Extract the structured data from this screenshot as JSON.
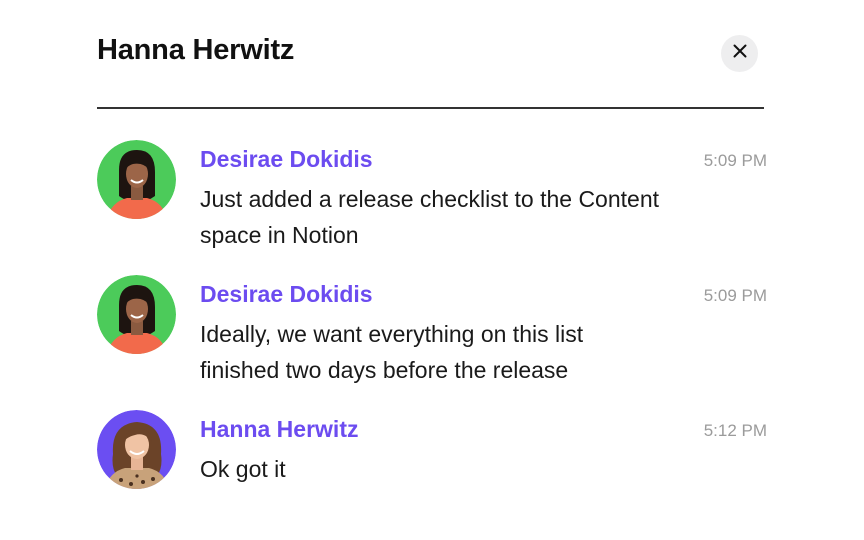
{
  "header": {
    "title": "Hanna Herwitz",
    "close_icon": "close-icon"
  },
  "colors": {
    "sender_name": "#6c4cf0",
    "timestamp": "#9b9b9b",
    "avatar_green": "#4ccb5a",
    "avatar_purple": "#6b4ef2"
  },
  "messages": [
    {
      "sender": "Desirae Dokidis",
      "time": "5:09 PM",
      "text": "Just added a release checklist to the Content space in Notion",
      "avatar": "desirae-avatar-photo"
    },
    {
      "sender": "Desirae Dokidis",
      "time": "5:09 PM",
      "text": "Ideally, we want everything on this list finished two days before the release",
      "avatar": "desirae-avatar-photo"
    },
    {
      "sender": "Hanna Herwitz",
      "time": "5:12 PM",
      "text": "Ok got it",
      "avatar": "hanna-avatar-photo"
    }
  ]
}
